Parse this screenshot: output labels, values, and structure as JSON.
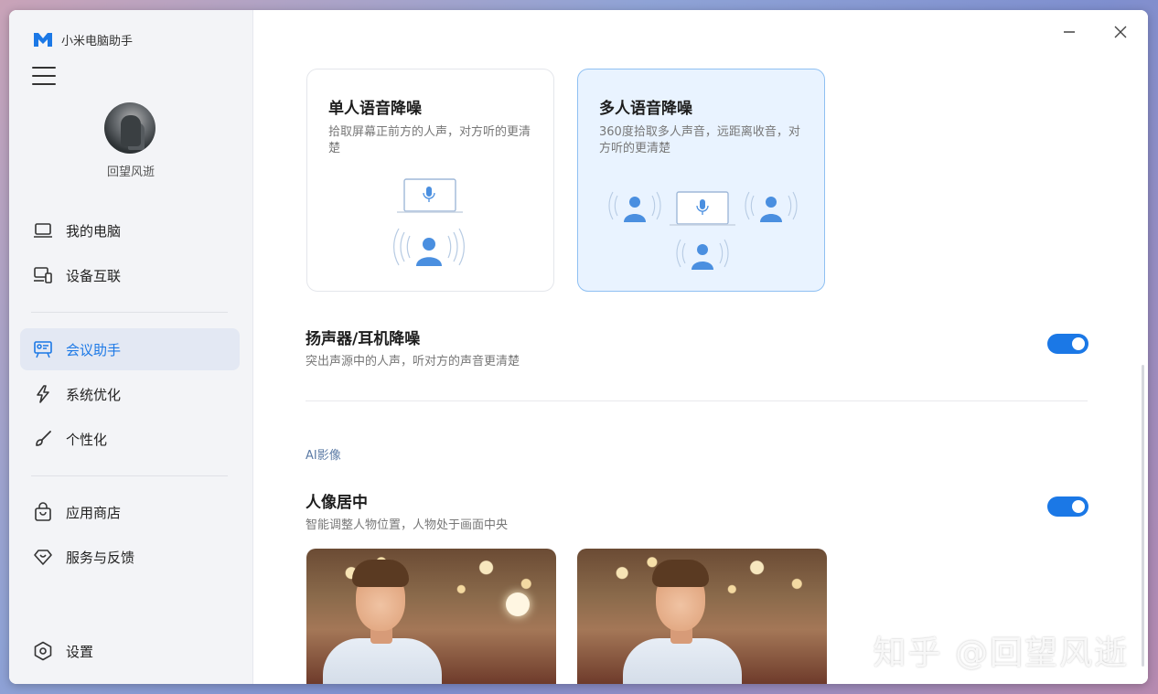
{
  "app": {
    "name": "小米电脑助手"
  },
  "user": {
    "name": "回望风逝"
  },
  "sidebar": {
    "items": [
      {
        "label": "我的电脑",
        "icon": "laptop-icon"
      },
      {
        "label": "设备互联",
        "icon": "device-link-icon"
      },
      {
        "label": "会议助手",
        "icon": "meeting-icon",
        "active": true
      },
      {
        "label": "系统优化",
        "icon": "lightning-icon"
      },
      {
        "label": "个性化",
        "icon": "brush-icon"
      },
      {
        "label": "应用商店",
        "icon": "shopping-bag-icon"
      },
      {
        "label": "服务与反馈",
        "icon": "diamond-heart-icon"
      }
    ],
    "settings_label": "设置"
  },
  "noise_cards": [
    {
      "title": "单人语音降噪",
      "desc": "拾取屏幕正前方的人声，对方听的更清楚",
      "selected": false
    },
    {
      "title": "多人语音降噪",
      "desc": "360度拾取多人声音，远距离收音，对方听的更清楚",
      "selected": true
    }
  ],
  "speaker_noise": {
    "title": "扬声器/耳机降噪",
    "desc": "突出声源中的人声，听对方的声音更清楚",
    "enabled": true
  },
  "ai_section": {
    "label": "AI影像"
  },
  "portrait_center": {
    "title": "人像居中",
    "desc": "智能调整人物位置，人物处于画面中央",
    "enabled": true
  },
  "watermark": "知乎 @回望风逝",
  "colors": {
    "accent": "#1b78e6",
    "selected_card_bg": "#e9f3ff",
    "sidebar_bg": "#f3f4f7",
    "illus_blue": "#4a8fe0"
  }
}
